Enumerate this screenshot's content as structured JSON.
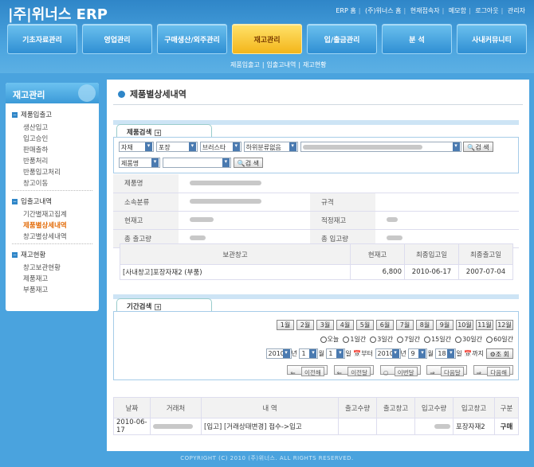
{
  "header": {
    "logo": "|주|위너스 ERP",
    "links": [
      "ERP 홈",
      "(주)위너스 홈",
      "현재접속자",
      "메모함",
      "로그아웃",
      "관리자"
    ]
  },
  "menu": [
    "기초자료관리",
    "영업관리",
    "구매생산/외주관리",
    "재고관리",
    "입/출금관리",
    "분 석",
    "사내커뮤니티"
  ],
  "submenu": [
    "제품입출고",
    "입출고내역",
    "재고현황"
  ],
  "sidebar": {
    "title": "재고관리",
    "groups": [
      {
        "label": "제품입출고",
        "items": [
          "생산입고",
          "입고승인",
          "판매출하",
          "반품처리",
          "반품입고처리",
          "창고이동"
        ]
      },
      {
        "label": "입출고내역",
        "items": [
          "기간별재고집계",
          "제품별상세내역",
          "창고별상세내역"
        ]
      },
      {
        "label": "재고현황",
        "items": [
          "창고보관현황",
          "제품재고",
          "부품재고"
        ]
      }
    ]
  },
  "page": {
    "title": "제품별상세내역"
  },
  "search": {
    "tab": "제품검색",
    "sel1": "자재",
    "sel2": "포장",
    "sel3": "브러스타",
    "sel4": "하위분류없음",
    "search_btn": "검 색",
    "sel5": "제품명",
    "search_btn2": "검 색"
  },
  "info": {
    "l_name": "제품명",
    "l_cat": "소속분류",
    "l_spec": "규격",
    "l_stock": "현재고",
    "l_proper": "적정재고",
    "l_out": "총 출고량",
    "l_in": "총 입고량"
  },
  "storage": {
    "headers": [
      "보관창고",
      "현재고",
      "최종입고일",
      "최종출고일"
    ],
    "row": [
      "[사내창고]포장자재2 (부품)",
      "6,800",
      "2010-06-17",
      "2007-07-04"
    ]
  },
  "period": {
    "tab": "기간검색",
    "months": [
      "1월",
      "2월",
      "3월",
      "4월",
      "5월",
      "6월",
      "7월",
      "8월",
      "9월",
      "10월",
      "11월",
      "12월"
    ],
    "radios": [
      "오늘",
      "1일간",
      "3일간",
      "7일간",
      "15일간",
      "30일간",
      "60일간"
    ],
    "from_y": "2010",
    "from_m": "1",
    "from_d": "1",
    "to_y": "2010",
    "to_m": "9",
    "to_d": "18",
    "u_year": "년",
    "u_month": "월",
    "u_day": "일",
    "u_from": "부터",
    "u_to": "까지",
    "query": "조 회",
    "nav": [
      "이전해",
      "이전달",
      "이번달",
      "다음달",
      "다음해"
    ]
  },
  "history": {
    "headers": [
      "날짜",
      "거래처",
      "내 역",
      "출고수량",
      "출고창고",
      "입고수량",
      "입고창고",
      "구분"
    ],
    "row": [
      "2010-06-17",
      "[입고] [거래상태변경] 접수->입고",
      "포장자재2",
      "구매"
    ]
  },
  "footer": "COPYRIGHT (C) 2010 (주)위너스. ALL RIGHTS RESERVED."
}
